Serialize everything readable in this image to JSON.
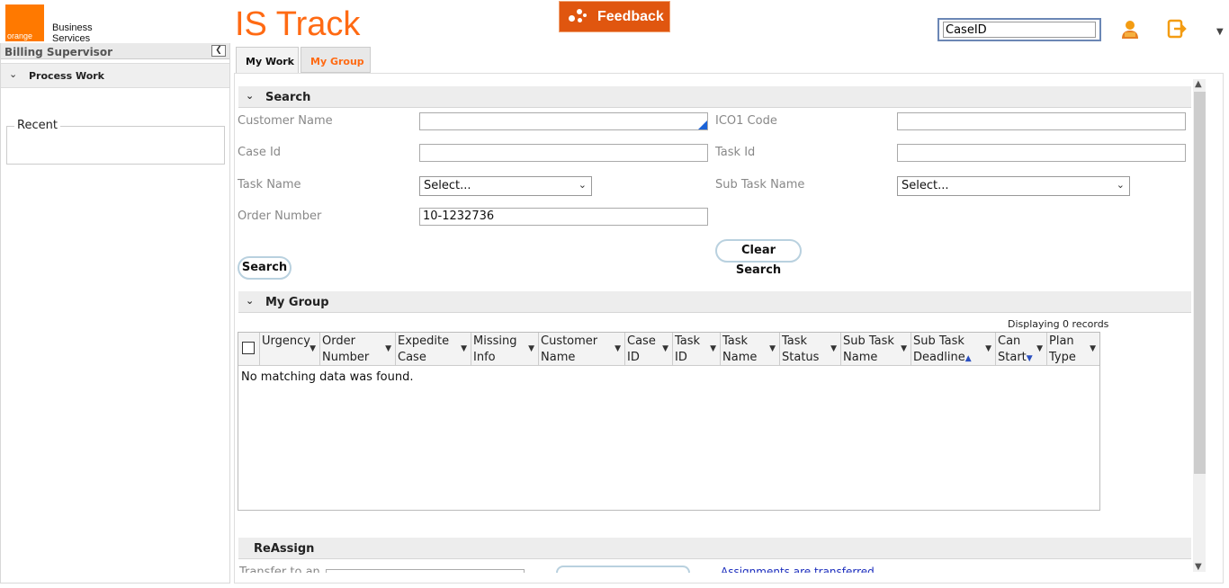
{
  "header": {
    "logo_text": "orange",
    "brand_text": "Business Services",
    "app_title": "IS Track",
    "feedback_label": "Feedback",
    "caseid_value": "CaseID"
  },
  "sidebar": {
    "role": "Billing Supervisor",
    "process_work_label": "Process Work",
    "recent_label": "Recent"
  },
  "tabs": [
    {
      "label": "My Work"
    },
    {
      "label": "My Group"
    }
  ],
  "search": {
    "section_title": "Search",
    "customer_name_label": "Customer Name",
    "customer_name_value": "",
    "ico1_code_label": "ICO1 Code",
    "ico1_code_value": "",
    "case_id_label": "Case Id",
    "case_id_value": "",
    "task_id_label": "Task Id",
    "task_id_value": "",
    "task_name_label": "Task Name",
    "task_name_value": "Select...",
    "sub_task_name_label": "Sub Task Name",
    "sub_task_name_value": "Select...",
    "order_number_label": "Order Number",
    "order_number_value": "10-1232736",
    "clear_search_label": "Clear Search",
    "search_label": "Search"
  },
  "my_group": {
    "section_title": "My Group",
    "records_text": "Displaying 0 records",
    "columns": [
      {
        "l1": "Urgency",
        "l2": ""
      },
      {
        "l1": "Order",
        "l2": "Number"
      },
      {
        "l1": "Expedite",
        "l2": "Case"
      },
      {
        "l1": "Missing",
        "l2": "Info"
      },
      {
        "l1": "Customer",
        "l2": "Name"
      },
      {
        "l1": "Case",
        "l2": "ID"
      },
      {
        "l1": "Task",
        "l2": "ID"
      },
      {
        "l1": "Task",
        "l2": "Name"
      },
      {
        "l1": "Task",
        "l2": "Status"
      },
      {
        "l1": "Sub Task",
        "l2": "Name"
      },
      {
        "l1": "Sub Task",
        "l2": "Deadline"
      },
      {
        "l1": "Can",
        "l2": "Start"
      },
      {
        "l1": "Plan",
        "l2": "Type"
      }
    ],
    "empty_text": "No matching data was found."
  },
  "reassign": {
    "section_title": "ReAssign",
    "transfer_label": "Transfer to an",
    "transfer_message": "Assignments are transferred"
  },
  "colors": {
    "brand_orange": "#ff7900",
    "title_orange": "#ff6a13",
    "feedback_bg": "#e0560f"
  },
  "icons": [
    "user-icon",
    "logout-icon",
    "chevron-down-icon",
    "collapse-left-icon",
    "feedback-dots-icon"
  ]
}
